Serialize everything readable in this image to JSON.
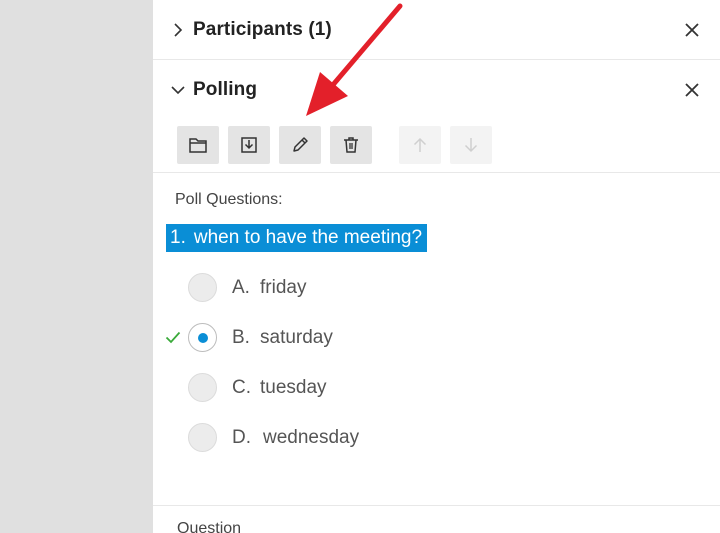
{
  "participants": {
    "title": "Participants (1)"
  },
  "polling": {
    "title": "Polling",
    "toolbar": [
      "folder-icon",
      "download-icon",
      "edit-icon",
      "delete-icon",
      "arrow-up-icon",
      "arrow-down-icon"
    ],
    "poll_questions_label": "Poll Questions:",
    "question": {
      "number": "1.",
      "text": "when to have the meeting?"
    },
    "options": [
      {
        "letter": "A.",
        "text": "friday",
        "selected": false
      },
      {
        "letter": "B.",
        "text": "saturday",
        "selected": true
      },
      {
        "letter": "C.",
        "text": "tuesday",
        "selected": false
      },
      {
        "letter": "D.",
        "text": "wednesday",
        "selected": false
      }
    ],
    "footer_label": "Question"
  },
  "colors": {
    "accent": "#0a8ed6",
    "arrow": "#e3202a",
    "check": "#3aaa3a",
    "sidebar": "#e0e0e0"
  }
}
